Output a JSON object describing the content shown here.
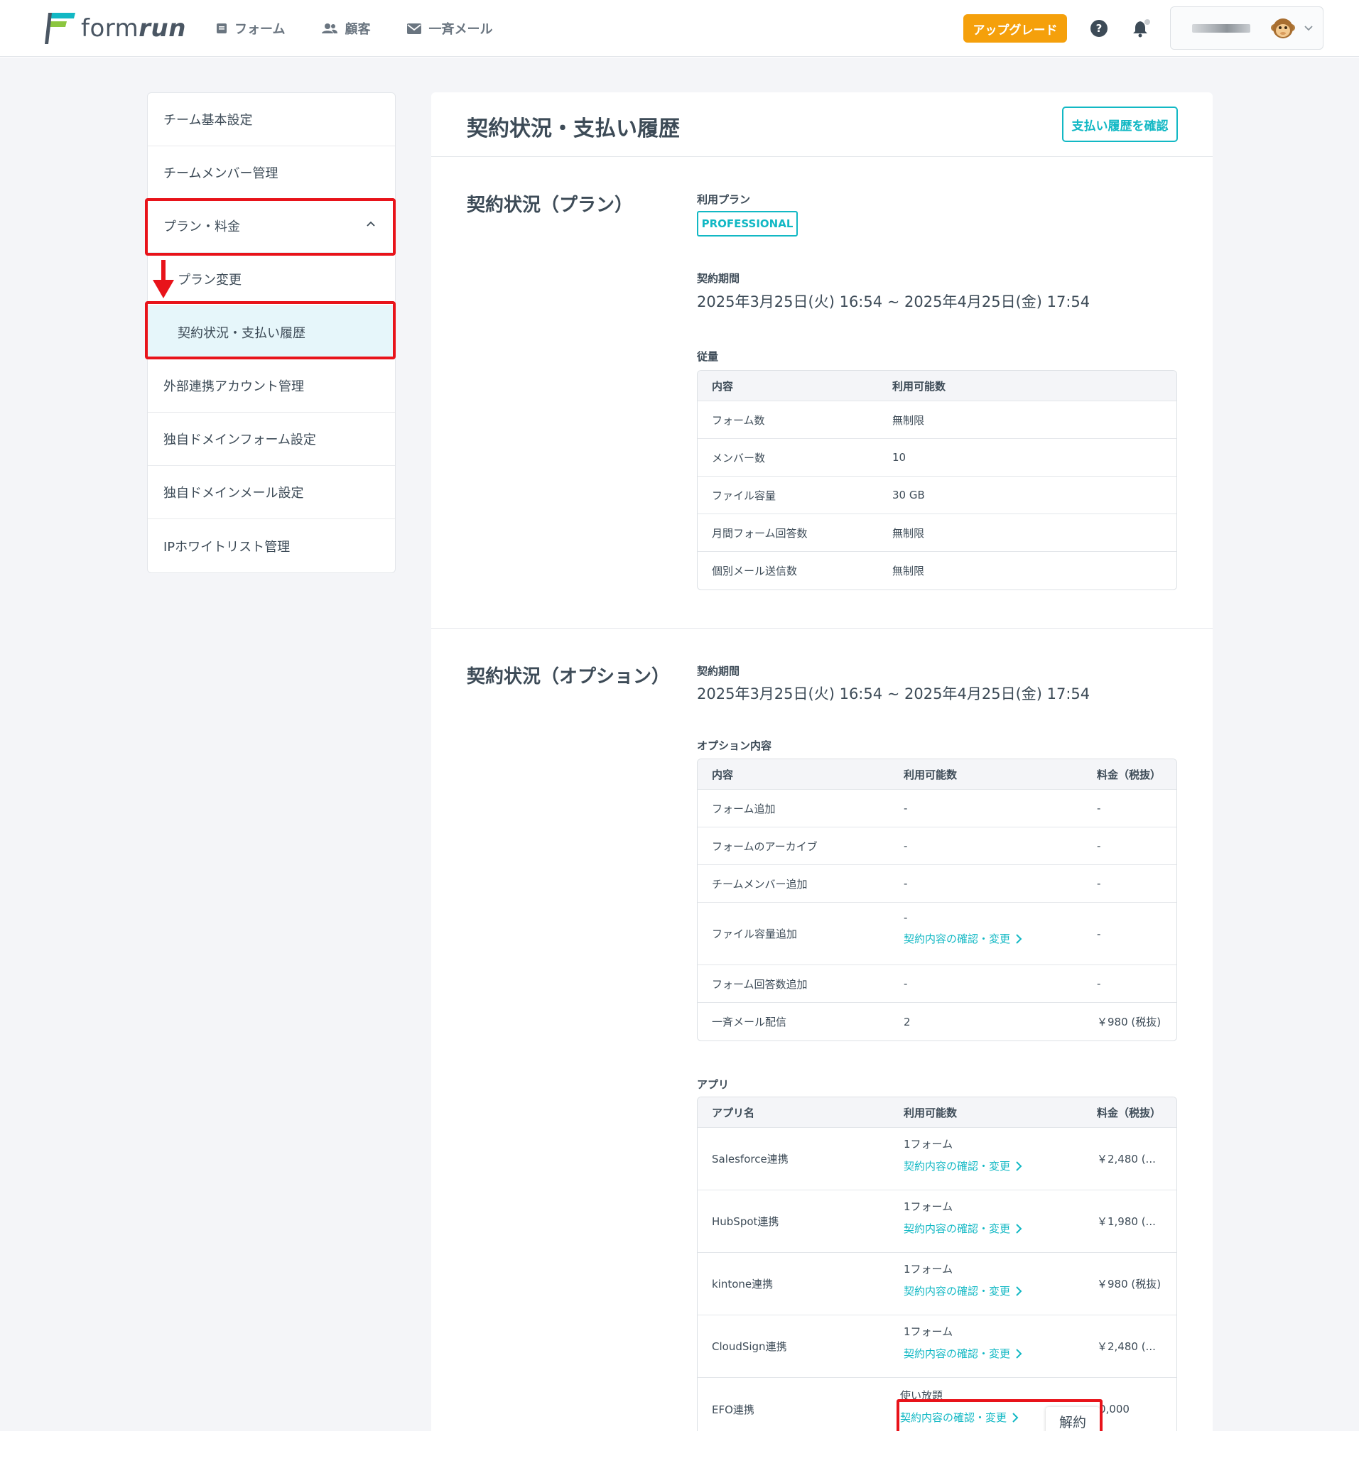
{
  "brand": {
    "name_plain": "form",
    "name_bold": "run",
    "accent": "#12b8c4",
    "upgrade_color": "#f5a00b",
    "highlight_color": "#e8131a"
  },
  "nav": [
    {
      "label": "フォーム",
      "icon": "form-icon"
    },
    {
      "label": "顧客",
      "icon": "users-icon"
    },
    {
      "label": "一斉メール",
      "icon": "mail-icon"
    }
  ],
  "header": {
    "upgrade_label": "アップグレード"
  },
  "sidebar": {
    "items": [
      {
        "label": "チーム基本設定"
      },
      {
        "label": "チームメンバー管理"
      },
      {
        "label": "プラン・料金"
      },
      {
        "label": "プラン変更"
      },
      {
        "label": "契約状況・支払い履歴"
      },
      {
        "label": "外部連携アカウント管理"
      },
      {
        "label": "独自ドメインフォーム設定"
      },
      {
        "label": "独自ドメインメール設定"
      },
      {
        "label": "IPホワイトリスト管理"
      }
    ]
  },
  "main": {
    "title": "契約状況・支払い履歴",
    "pay_history_button": "支払い履歴を確認",
    "plan_section": {
      "title": "契約状況（プラン）",
      "plan_label": "利用プラン",
      "plan_name": "PROFESSIONAL",
      "period_label": "契約期間",
      "period": "2025年3月25日(火) 16:54 ~ 2025年4月25日(金) 17:54",
      "usage_label": "従量",
      "usage_headers": [
        "内容",
        "利用可能数"
      ],
      "usage_rows": [
        [
          "フォーム数",
          "無制限"
        ],
        [
          "メンバー数",
          "10"
        ],
        [
          "ファイル容量",
          "30 GB"
        ],
        [
          "月間フォーム回答数",
          "無制限"
        ],
        [
          "個別メール送信数",
          "無制限"
        ]
      ]
    },
    "option_section": {
      "title": "契約状況（オプション）",
      "period_label": "契約期間",
      "period": "2025年3月25日(火) 16:54 ~ 2025年4月25日(金) 17:54",
      "options_label": "オプション内容",
      "options_headers": [
        "内容",
        "利用可能数",
        "料金（税抜）"
      ],
      "options_rows": [
        [
          "フォーム追加",
          "-",
          "-"
        ],
        [
          "フォームのアーカイブ",
          "-",
          "-"
        ],
        [
          "チームメンバー追加",
          "-",
          "-"
        ],
        [
          "ファイル容量追加",
          "-",
          "-"
        ],
        [
          "フォーム回答数追加",
          "-",
          "-"
        ],
        [
          "一斉メール配信",
          "2",
          "￥980 (税抜)"
        ]
      ],
      "apps_label": "アプリ",
      "apps_headers": [
        "アプリ名",
        "利用可能数",
        "料金（税抜）"
      ],
      "apps_rows": [
        [
          "Salesforce連携",
          "1フォーム",
          "￥2,480 (..."
        ],
        [
          "HubSpot連携",
          "1フォーム",
          "￥1,980 (..."
        ],
        [
          "kintone連携",
          "1フォーム",
          "￥980 (税抜)"
        ],
        [
          "CloudSign連携",
          "1フォーム",
          "￥2,480 (..."
        ],
        [
          "EFO連携",
          "使い放題",
          "0,000"
        ]
      ],
      "contract_link": "契約内容の確認・変更",
      "cancel_label": "解約"
    }
  }
}
